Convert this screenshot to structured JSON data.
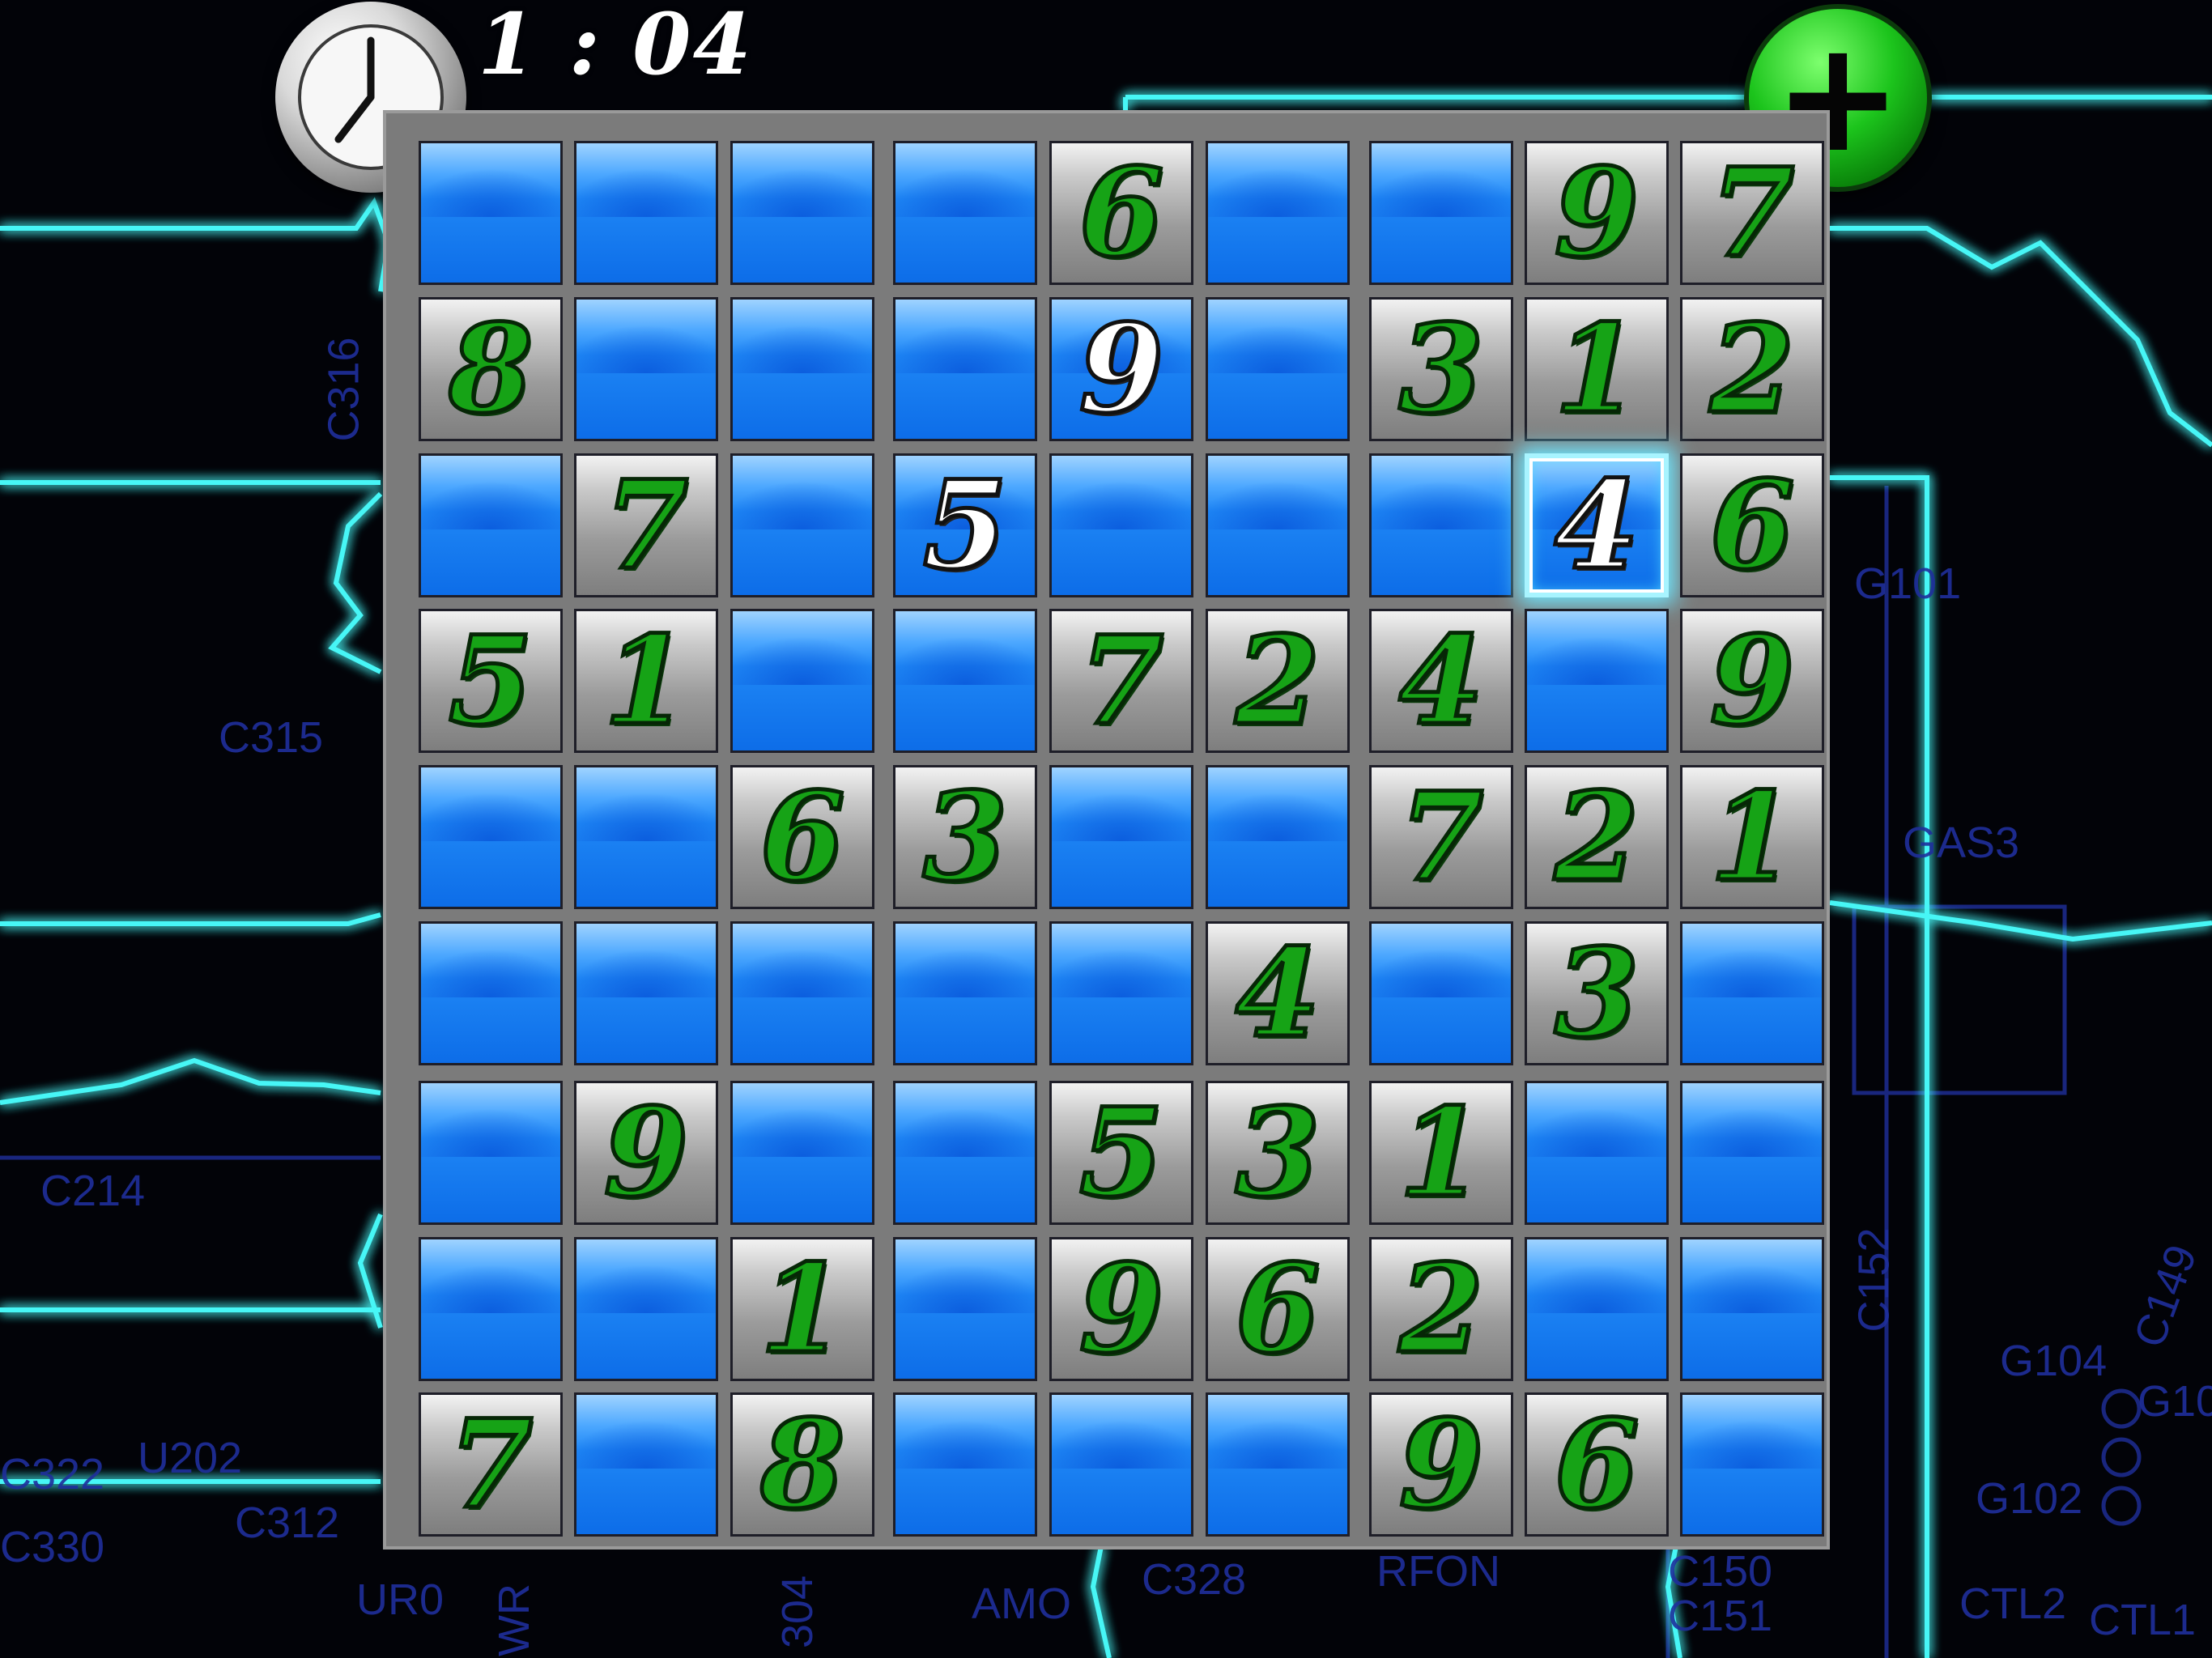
{
  "timer": {
    "text": "1 : 04",
    "icon": "clock-icon"
  },
  "add_button": {
    "label": "+",
    "icon": "plus-icon",
    "color": "#1cc41c"
  },
  "background_labels": [
    "C316",
    "C315",
    "C214",
    "C312",
    "C330",
    "U202",
    "C322",
    "C328",
    "RFON",
    "AMO",
    "G101",
    "GAS3",
    "G104",
    "G102",
    "CTL2",
    "CTL1",
    "C150",
    "C151",
    "C152",
    "C149",
    "G10",
    "304",
    "WR",
    "UR0"
  ],
  "colors": {
    "empty_cell": "#1e86f5",
    "given_digit": "#16a316",
    "user_digit": "#ffffff",
    "selection": "#6fe7ff",
    "circuit_glow": "#3ff2f2",
    "circuit_dim": "#1f2f9c"
  },
  "selected_cell": [
    2,
    7
  ],
  "grid": [
    [
      "",
      "",
      "",
      "",
      "6",
      "",
      "",
      "9",
      "7"
    ],
    [
      "8",
      "",
      "",
      "",
      "9",
      "",
      "3",
      "1",
      "2"
    ],
    [
      "",
      "7",
      "",
      "5",
      "",
      "",
      "",
      "4",
      "6"
    ],
    [
      "5",
      "1",
      "",
      "",
      "7",
      "2",
      "4",
      "",
      "9"
    ],
    [
      "",
      "",
      "6",
      "3",
      "",
      "",
      "7",
      "2",
      "1"
    ],
    [
      "",
      "",
      "",
      "",
      "",
      "4",
      "",
      "3",
      ""
    ],
    [
      "",
      "9",
      "",
      "",
      "5",
      "3",
      "1",
      "",
      ""
    ],
    [
      "",
      "",
      "1",
      "",
      "9",
      "6",
      "2",
      "",
      ""
    ],
    [
      "7",
      "",
      "8",
      "",
      "",
      "",
      "9",
      "6",
      ""
    ]
  ],
  "cell_type": [
    [
      "e",
      "e",
      "e",
      "e",
      "g",
      "e",
      "e",
      "g",
      "g"
    ],
    [
      "g",
      "e",
      "e",
      "e",
      "u",
      "e",
      "g",
      "g",
      "g"
    ],
    [
      "e",
      "g",
      "e",
      "u",
      "e",
      "e",
      "e",
      "u",
      "g"
    ],
    [
      "g",
      "g",
      "e",
      "e",
      "g",
      "g",
      "g",
      "e",
      "g"
    ],
    [
      "e",
      "e",
      "g",
      "g",
      "e",
      "e",
      "g",
      "g",
      "g"
    ],
    [
      "e",
      "e",
      "e",
      "e",
      "e",
      "g",
      "e",
      "g",
      "e"
    ],
    [
      "e",
      "g",
      "e",
      "e",
      "g",
      "g",
      "g",
      "e",
      "e"
    ],
    [
      "e",
      "e",
      "g",
      "e",
      "g",
      "g",
      "g",
      "e",
      "e"
    ],
    [
      "g",
      "e",
      "g",
      "e",
      "e",
      "e",
      "g",
      "g",
      "e"
    ]
  ]
}
